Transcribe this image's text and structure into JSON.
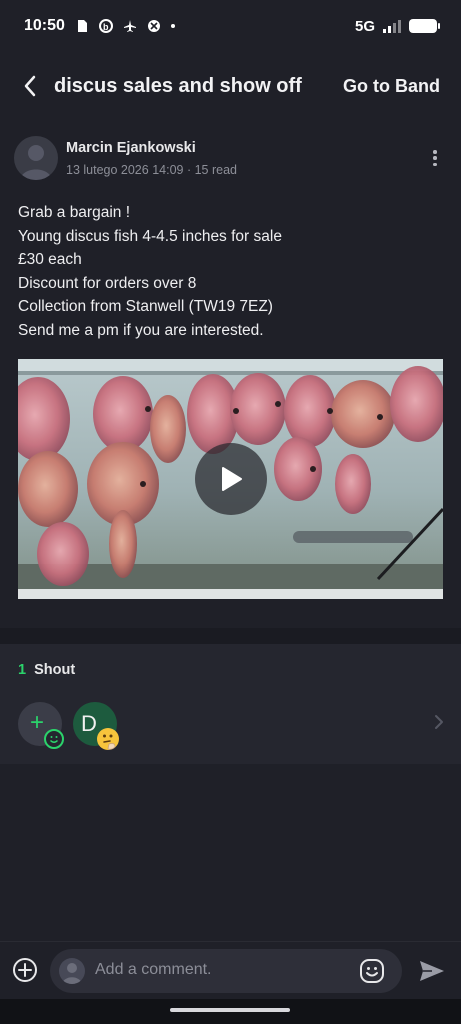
{
  "status_bar": {
    "time": "10:50",
    "network": "5G"
  },
  "header": {
    "title": "discus sales and show off",
    "action": "Go to Band"
  },
  "post": {
    "author": "Marcin Ejankowski",
    "meta": "13 lutego 2026 14:09 · 15 read",
    "lines": [
      "Grab a bargain  !",
      "Young discus fish 4-4.5 inches for sale",
      "£30 each",
      "Discount for orders over 8",
      "Collection from Stanwell (TW19 7EZ)",
      "Send me a pm if you are interested."
    ]
  },
  "shouts": {
    "count": "1",
    "label": "Shout",
    "user_initial": "D"
  },
  "comment": {
    "placeholder": "Add a comment."
  },
  "colors": {
    "accent": "#2bd36b",
    "background": "#1f2028",
    "panel": "#25262f"
  }
}
